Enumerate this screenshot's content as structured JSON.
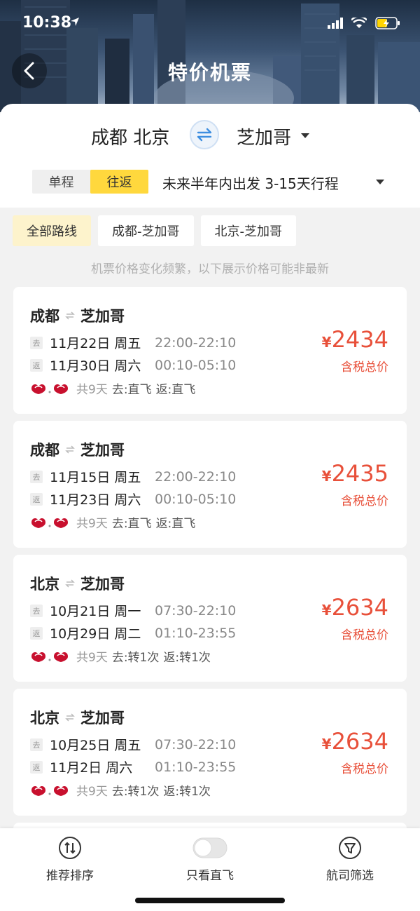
{
  "status": {
    "time": "10:38"
  },
  "header": {
    "title": "特价机票"
  },
  "route": {
    "from": "成都 北京",
    "to": "芝加哥"
  },
  "trip": {
    "options": [
      {
        "label": "单程",
        "active": false
      },
      {
        "label": "往返",
        "active": true
      }
    ],
    "description": "未来半年内出发 3-15天行程"
  },
  "chips": [
    "全部路线",
    "成都-芝加哥",
    "北京-芝加哥"
  ],
  "notice": "机票价格变化频繁，以下展示价格可能非最新",
  "leg_tags": {
    "out": "去",
    "ret": "返"
  },
  "cards": [
    {
      "from": "成都",
      "to": "芝加哥",
      "out_date": "11月22日 周五",
      "out_time": "22:00-22:10",
      "ret_date": "11月30日 周六",
      "ret_time": "00:10-05:10",
      "duration": "共9天",
      "out_type": "去:直飞",
      "ret_type": "返:直飞",
      "currency": "¥",
      "price": "2434",
      "price_note": "含税总价"
    },
    {
      "from": "成都",
      "to": "芝加哥",
      "out_date": "11月15日 周五",
      "out_time": "22:00-22:10",
      "ret_date": "11月23日 周六",
      "ret_time": "00:10-05:10",
      "duration": "共9天",
      "out_type": "去:直飞",
      "ret_type": "返:直飞",
      "currency": "¥",
      "price": "2435",
      "price_note": "含税总价"
    },
    {
      "from": "北京",
      "to": "芝加哥",
      "out_date": "10月21日 周一",
      "out_time": "07:30-22:10",
      "ret_date": "10月29日 周二",
      "ret_time": "01:10-23:55",
      "duration": "共9天",
      "out_type": "去:转1次",
      "ret_type": "返:转1次",
      "currency": "¥",
      "price": "2634",
      "price_note": "含税总价"
    },
    {
      "from": "北京",
      "to": "芝加哥",
      "out_date": "10月25日 周五",
      "out_time": "07:30-22:10",
      "ret_date": "11月2日 周六",
      "ret_time": "01:10-23:55",
      "duration": "共9天",
      "out_type": "去:转1次",
      "ret_type": "返:转1次",
      "currency": "¥",
      "price": "2634",
      "price_note": "含税总价"
    }
  ],
  "bottom_bar": {
    "sort_label": "推荐排序",
    "direct_label": "只看直飞",
    "direct_on": false,
    "airline_label": "航司筛选"
  },
  "colors": {
    "accent_yellow": "#ffd83d",
    "price_red": "#e8503a",
    "swap_blue": "#3d8ee0",
    "airline_red": "#c8102e"
  }
}
